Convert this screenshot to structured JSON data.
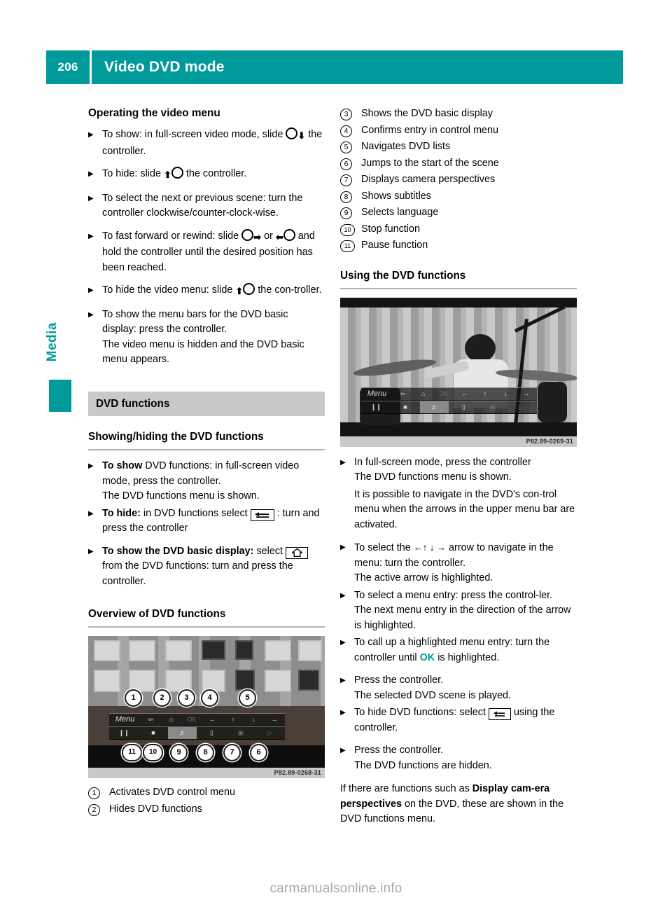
{
  "header": {
    "page_number": "206",
    "title": "Video DVD mode",
    "accent_color": "#009a9a"
  },
  "side_tab": {
    "label": "Media"
  },
  "left_column": {
    "section_operating": {
      "title": "Operating the video menu",
      "items": [
        {
          "pre": "To show: in full-screen video mode, slide",
          "glyph": "controller-down",
          "post": "the controller."
        },
        {
          "pre": "To hide: slide",
          "glyph": "controller-up",
          "post": "the controller."
        },
        {
          "text": "To select the next or previous scene: turn the controller clockwise/counter-clock-wise."
        },
        {
          "pre": "To fast forward or rewind: slide",
          "glyph": "controller-right",
          "mid": "or",
          "glyph2": "controller-left",
          "post": "and hold the controller until the desired position has been reached."
        },
        {
          "pre": "To hide the video menu: slide",
          "glyph": "controller-up",
          "post": "the con-troller."
        },
        {
          "text": "To show the menu bars for the DVD basic display: press the controller.",
          "note": "The video menu is hidden and the DVD basic menu appears."
        }
      ]
    },
    "band_title": "DVD functions",
    "section_showhide": {
      "title": "Showing/hiding the DVD functions",
      "item1_bold": "To show",
      "item1_rest": "DVD functions: in full-screen video mode, press the controller.",
      "item1_note": "The DVD functions menu is shown.",
      "item2_bold": "To hide:",
      "item2_pre": "in DVD functions select",
      "item2_glyph": "back-arrow-key",
      "item2_post": ": turn and press the controller",
      "item3_bold": "To show the DVD basic display:",
      "item3_pre": "select",
      "item3_glyph": "home-key",
      "item3_post": "from the DVD functions: turn and press the controller."
    },
    "section_overview": {
      "title": "Overview of DVD functions",
      "figure": {
        "caption": "P82.89-0268-31",
        "osd_top": [
          "Menu",
          "back-arrow-icon",
          "home-icon",
          "OK",
          "←",
          "↑",
          "↓",
          "→"
        ],
        "osd_bottom": [
          "❙❙",
          "■",
          "language-icon",
          "subtitle-icon",
          "camera-icon",
          "scene-start-icon"
        ],
        "callouts": [
          "1",
          "2",
          "3",
          "4",
          "5",
          "6",
          "7",
          "8",
          "9",
          "10",
          "11"
        ]
      },
      "legend": [
        {
          "num": "1",
          "text": "Activates DVD control menu"
        },
        {
          "num": "2",
          "text": "Hides DVD functions"
        }
      ]
    }
  },
  "right_column": {
    "legend_continued": [
      {
        "num": "3",
        "text": "Shows the DVD basic display"
      },
      {
        "num": "4",
        "text": "Confirms entry in control menu"
      },
      {
        "num": "5",
        "text": "Navigates DVD lists"
      },
      {
        "num": "6",
        "text": "Jumps to the start of the scene"
      },
      {
        "num": "7",
        "text": "Displays camera perspectives"
      },
      {
        "num": "8",
        "text": "Shows subtitles"
      },
      {
        "num": "9",
        "text": "Selects language"
      },
      {
        "num": "10",
        "text": "Stop function"
      },
      {
        "num": "11",
        "text": "Pause function"
      }
    ],
    "section_using": {
      "title": "Using the DVD functions",
      "figure": {
        "caption": "P82.89-0269-31",
        "osd_top": [
          "Menu",
          "back-arrow-icon",
          "home-icon",
          "OK",
          "←",
          "↑",
          "↓",
          "→"
        ],
        "osd_bottom": [
          "❙❙",
          "■",
          "language-icon",
          "subtitle-icon",
          "camera-icon",
          "scene-start-icon"
        ]
      },
      "items": [
        {
          "text": "In full-screen mode, press the controller",
          "note": "The DVD functions menu is shown."
        },
        {
          "para": "It is possible to navigate in the DVD's con-trol menu when the arrows in the upper menu bar are activated."
        },
        {
          "pre": "To select the",
          "arrows": "←↑  ↓  →",
          "post": "arrow to navigate in the menu: turn the controller.",
          "note": "The active arrow is highlighted."
        },
        {
          "text": "To select a menu entry: press the control-ler.",
          "note": "The next menu entry in the direction of the arrow is highlighted."
        },
        {
          "pre": "To call up a highlighted menu entry: turn the controller until",
          "highlight": "OK",
          "post": "is highlighted."
        },
        {
          "text": "Press the controller.",
          "note": "The selected DVD scene is played."
        },
        {
          "pre": "To hide DVD functions: select",
          "glyph": "back-arrow-key",
          "post": "using the controller."
        },
        {
          "text": "Press the controller.",
          "note": "The DVD functions are hidden."
        }
      ],
      "closing_pre": "If there are functions such as",
      "closing_bold": "Display cam-era perspectives",
      "closing_post": "on the DVD, these are shown in the DVD functions menu."
    }
  },
  "footer": {
    "watermark": "carmanualsonline.info"
  }
}
